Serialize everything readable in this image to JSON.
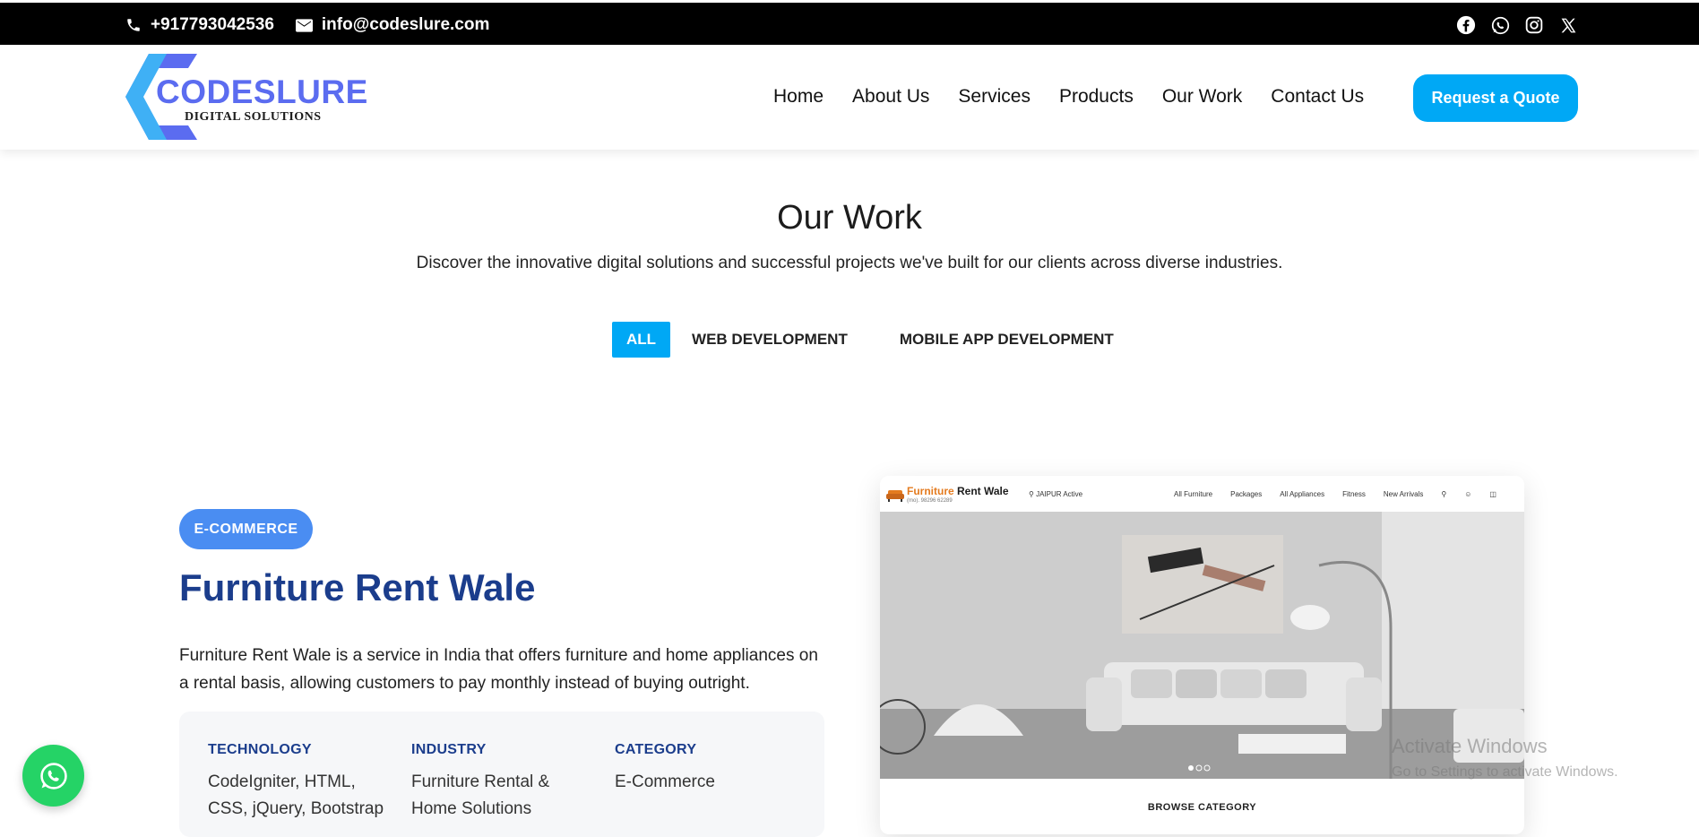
{
  "topbar": {
    "phone": "+917793042536",
    "email": "info@codeslure.com",
    "social": [
      "facebook-icon",
      "whatsapp-icon",
      "instagram-icon",
      "x-icon"
    ]
  },
  "header": {
    "logo": {
      "brand": "CODESLURE",
      "tagline": "DIGITAL SOLUTIONS"
    },
    "nav": [
      "Home",
      "About Us",
      "Services",
      "Products",
      "Our Work",
      "Contact Us"
    ],
    "cta": "Request a Quote"
  },
  "page": {
    "title": "Our Work",
    "subtitle": "Discover the innovative digital solutions and successful projects we've built for our clients across diverse industries.",
    "filters": [
      "ALL",
      "WEB DEVELOPMENT",
      "MOBILE APP DEVELOPMENT"
    ],
    "active_filter": "ALL"
  },
  "project": {
    "badge": "E-COMMERCE",
    "title": "Furniture Rent Wale",
    "description": "Furniture Rent Wale is a service in India that offers furniture and home appliances on a rental basis, allowing customers to pay monthly instead of buying outright.",
    "meta": [
      {
        "label": "TECHNOLOGY",
        "value": "CodeIgniter, HTML, CSS, jQuery, Bootstrap"
      },
      {
        "label": "INDUSTRY",
        "value": "Furniture Rental & Home Solutions"
      },
      {
        "label": "CATEGORY",
        "value": "E-Commerce"
      }
    ],
    "screenshot": {
      "logo_word1": "Furniture",
      "logo_word2": " Rent Wale",
      "phone": "(mo). 98296 62289",
      "location": "JAIPUR Active",
      "links": [
        "All Furniture",
        "Packages",
        "All Appliances",
        "Fitness",
        "New Arrivals"
      ],
      "browse": "BROWSE CATEGORY"
    }
  },
  "watermark": {
    "line1": "Activate Windows",
    "line2": "Go to Settings to activate Windows."
  },
  "colors": {
    "accent": "#00a8f5",
    "brand_blue": "#1b3d8c",
    "badge_blue": "#4a8df2",
    "whatsapp": "#25d366"
  }
}
